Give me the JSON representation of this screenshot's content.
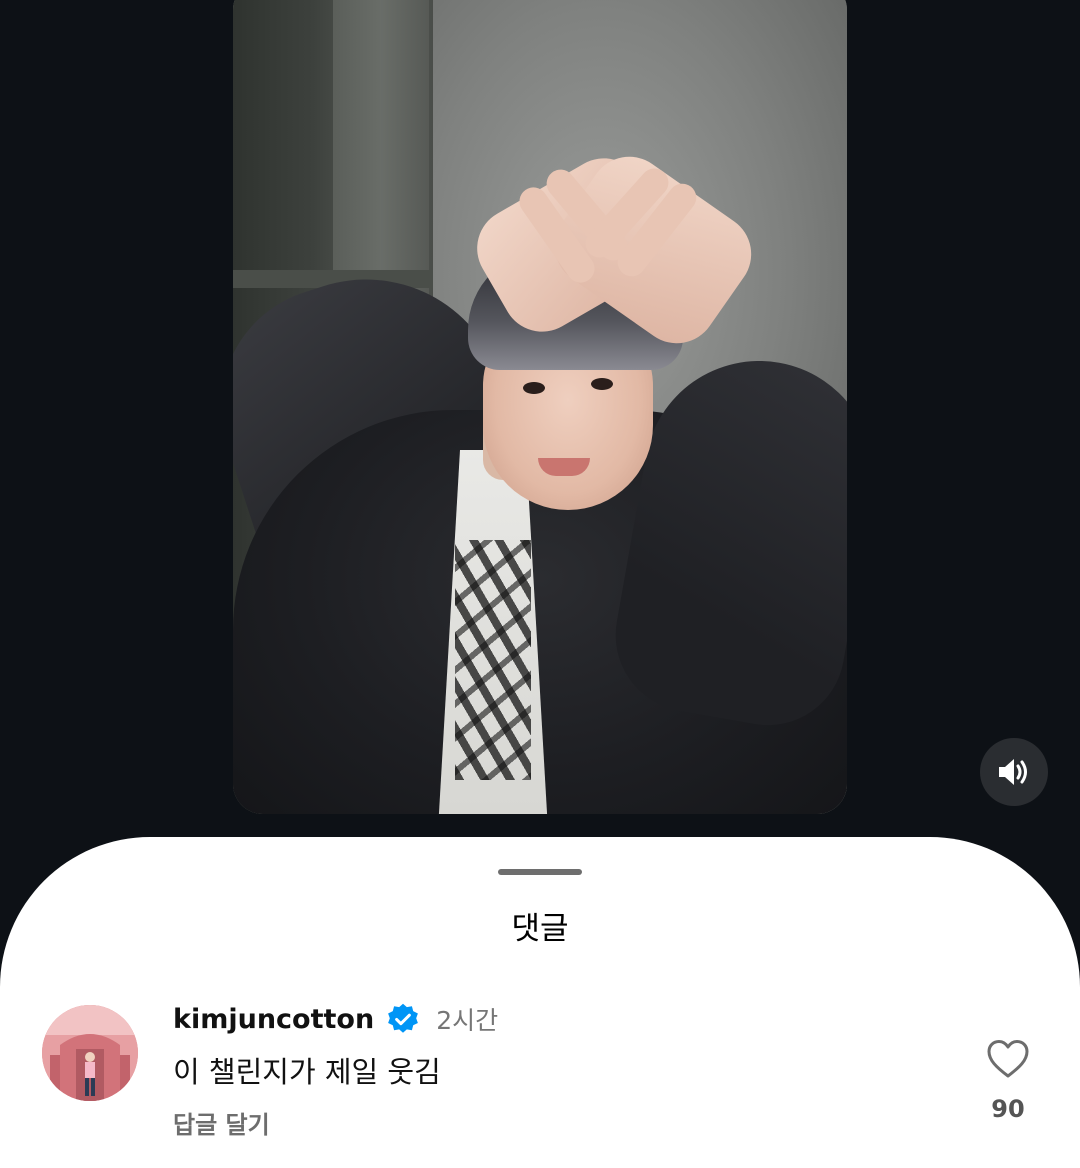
{
  "media": {
    "type": "video",
    "sound_icon": "speaker-icon"
  },
  "comments_sheet": {
    "title": "댓글",
    "comment": {
      "username": "kimjuncotton",
      "verified_icon": "verified-badge-icon",
      "time": "2시간",
      "text": "이 챌린지가 제일 웃김",
      "reply_label": "답글 달기",
      "like_icon": "heart-outline-icon",
      "like_count": "90"
    }
  },
  "colors": {
    "background": "#0d1116",
    "sheet": "#ffffff",
    "verified": "#0095f6",
    "secondary_text": "#767676"
  }
}
